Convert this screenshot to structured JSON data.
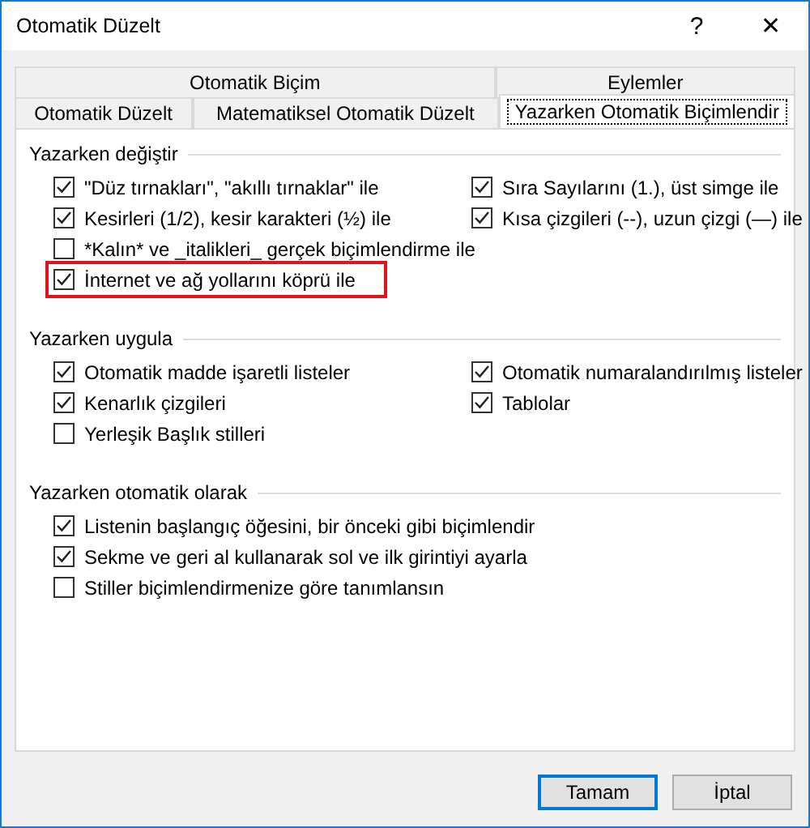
{
  "window": {
    "title": "Otomatik Düzelt",
    "help": "?",
    "close": "✕"
  },
  "tab_rows": [
    [
      {
        "label": "Otomatik Biçim",
        "selected": false
      },
      {
        "label": "Eylemler",
        "selected": false
      }
    ],
    [
      {
        "label": "Otomatik Düzelt",
        "selected": false
      },
      {
        "label": "Matematiksel Otomatik Düzelt",
        "selected": false
      },
      {
        "label": "Yazarken Otomatik Biçimlendir",
        "selected": true
      }
    ]
  ],
  "groups": [
    {
      "title": "Yazarken değiştir",
      "rows": [
        [
          {
            "label": "\"Düz tırnakları\", \"akıllı tırnaklar\" ile",
            "checked": true,
            "highlighted": false
          },
          {
            "label": "Sıra Sayılarını (1.), üst simge ile",
            "checked": true,
            "highlighted": false
          }
        ],
        [
          {
            "label": "Kesirleri (1/2), kesir karakteri (½) ile",
            "checked": true,
            "highlighted": false
          },
          {
            "label": "Kısa çizgileri (--), uzun çizgi (—) ile",
            "checked": true,
            "highlighted": false
          }
        ],
        [
          {
            "label": "*Kalın* ve _italikleri_ gerçek biçimlendirme ile",
            "checked": false,
            "highlighted": false
          }
        ],
        [
          {
            "label": "İnternet ve ağ yollarını köprü ile",
            "checked": true,
            "highlighted": true
          }
        ]
      ]
    },
    {
      "title": "Yazarken uygula",
      "rows": [
        [
          {
            "label": "Otomatik madde işaretli listeler",
            "checked": true,
            "highlighted": false
          },
          {
            "label": "Otomatik numaralandırılmış listeler",
            "checked": true,
            "highlighted": false
          }
        ],
        [
          {
            "label": "Kenarlık çizgileri",
            "checked": true,
            "highlighted": false
          },
          {
            "label": "Tablolar",
            "checked": true,
            "highlighted": false
          }
        ],
        [
          {
            "label": "Yerleşik Başlık stilleri",
            "checked": false,
            "highlighted": false
          }
        ]
      ]
    },
    {
      "title": "Yazarken otomatik olarak",
      "rows": [
        [
          {
            "label": "Listenin başlangıç öğesini, bir önceki gibi biçimlendir",
            "checked": true,
            "highlighted": false
          }
        ],
        [
          {
            "label": "Sekme ve geri al kullanarak sol ve ilk girintiyi ayarla",
            "checked": true,
            "highlighted": false
          }
        ],
        [
          {
            "label": "Stiller biçimlendirmenize göre tanımlansın",
            "checked": false,
            "highlighted": false
          }
        ]
      ]
    }
  ],
  "buttons": [
    {
      "label": "Tamam",
      "default": true
    },
    {
      "label": "İptal",
      "default": false
    }
  ]
}
